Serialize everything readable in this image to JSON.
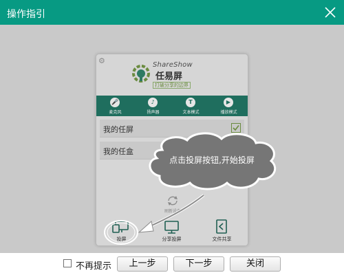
{
  "window": {
    "title": "操作指引",
    "close_icon": "close-icon"
  },
  "phone": {
    "brand_en": "ShareShow",
    "brand_cn": "任易屏",
    "tagline": "打破分享的边界",
    "modes": [
      {
        "label": "麦克风",
        "icon": "microphone-icon"
      },
      {
        "label": "扬声器",
        "icon": "speaker-icon"
      },
      {
        "label": "文本模式",
        "icon": "text-icon"
      },
      {
        "label": "播放模式",
        "icon": "play-icon"
      }
    ],
    "devices": [
      {
        "label": "我的任屏",
        "checked": true
      },
      {
        "label": "我的任盒",
        "checked": false
      }
    ],
    "refresh_label": "刷新设备",
    "tabs": [
      {
        "label": "投屏",
        "icon": "cast-icon"
      },
      {
        "label": "分享投屏",
        "icon": "share-cast-icon"
      },
      {
        "label": "文件共享",
        "icon": "file-share-icon"
      }
    ]
  },
  "guide": {
    "bubble_text": "点击投屏按钮,开始投屏"
  },
  "footer": {
    "dont_show_label": "不再提示",
    "prev_label": "上一步",
    "next_label": "下一步",
    "close_label": "关闭"
  },
  "colors": {
    "titlebar": "#079a83",
    "modebar": "#1f6e5e",
    "accent_green": "#6a8b3f",
    "overlay": "#c9c9c9"
  }
}
